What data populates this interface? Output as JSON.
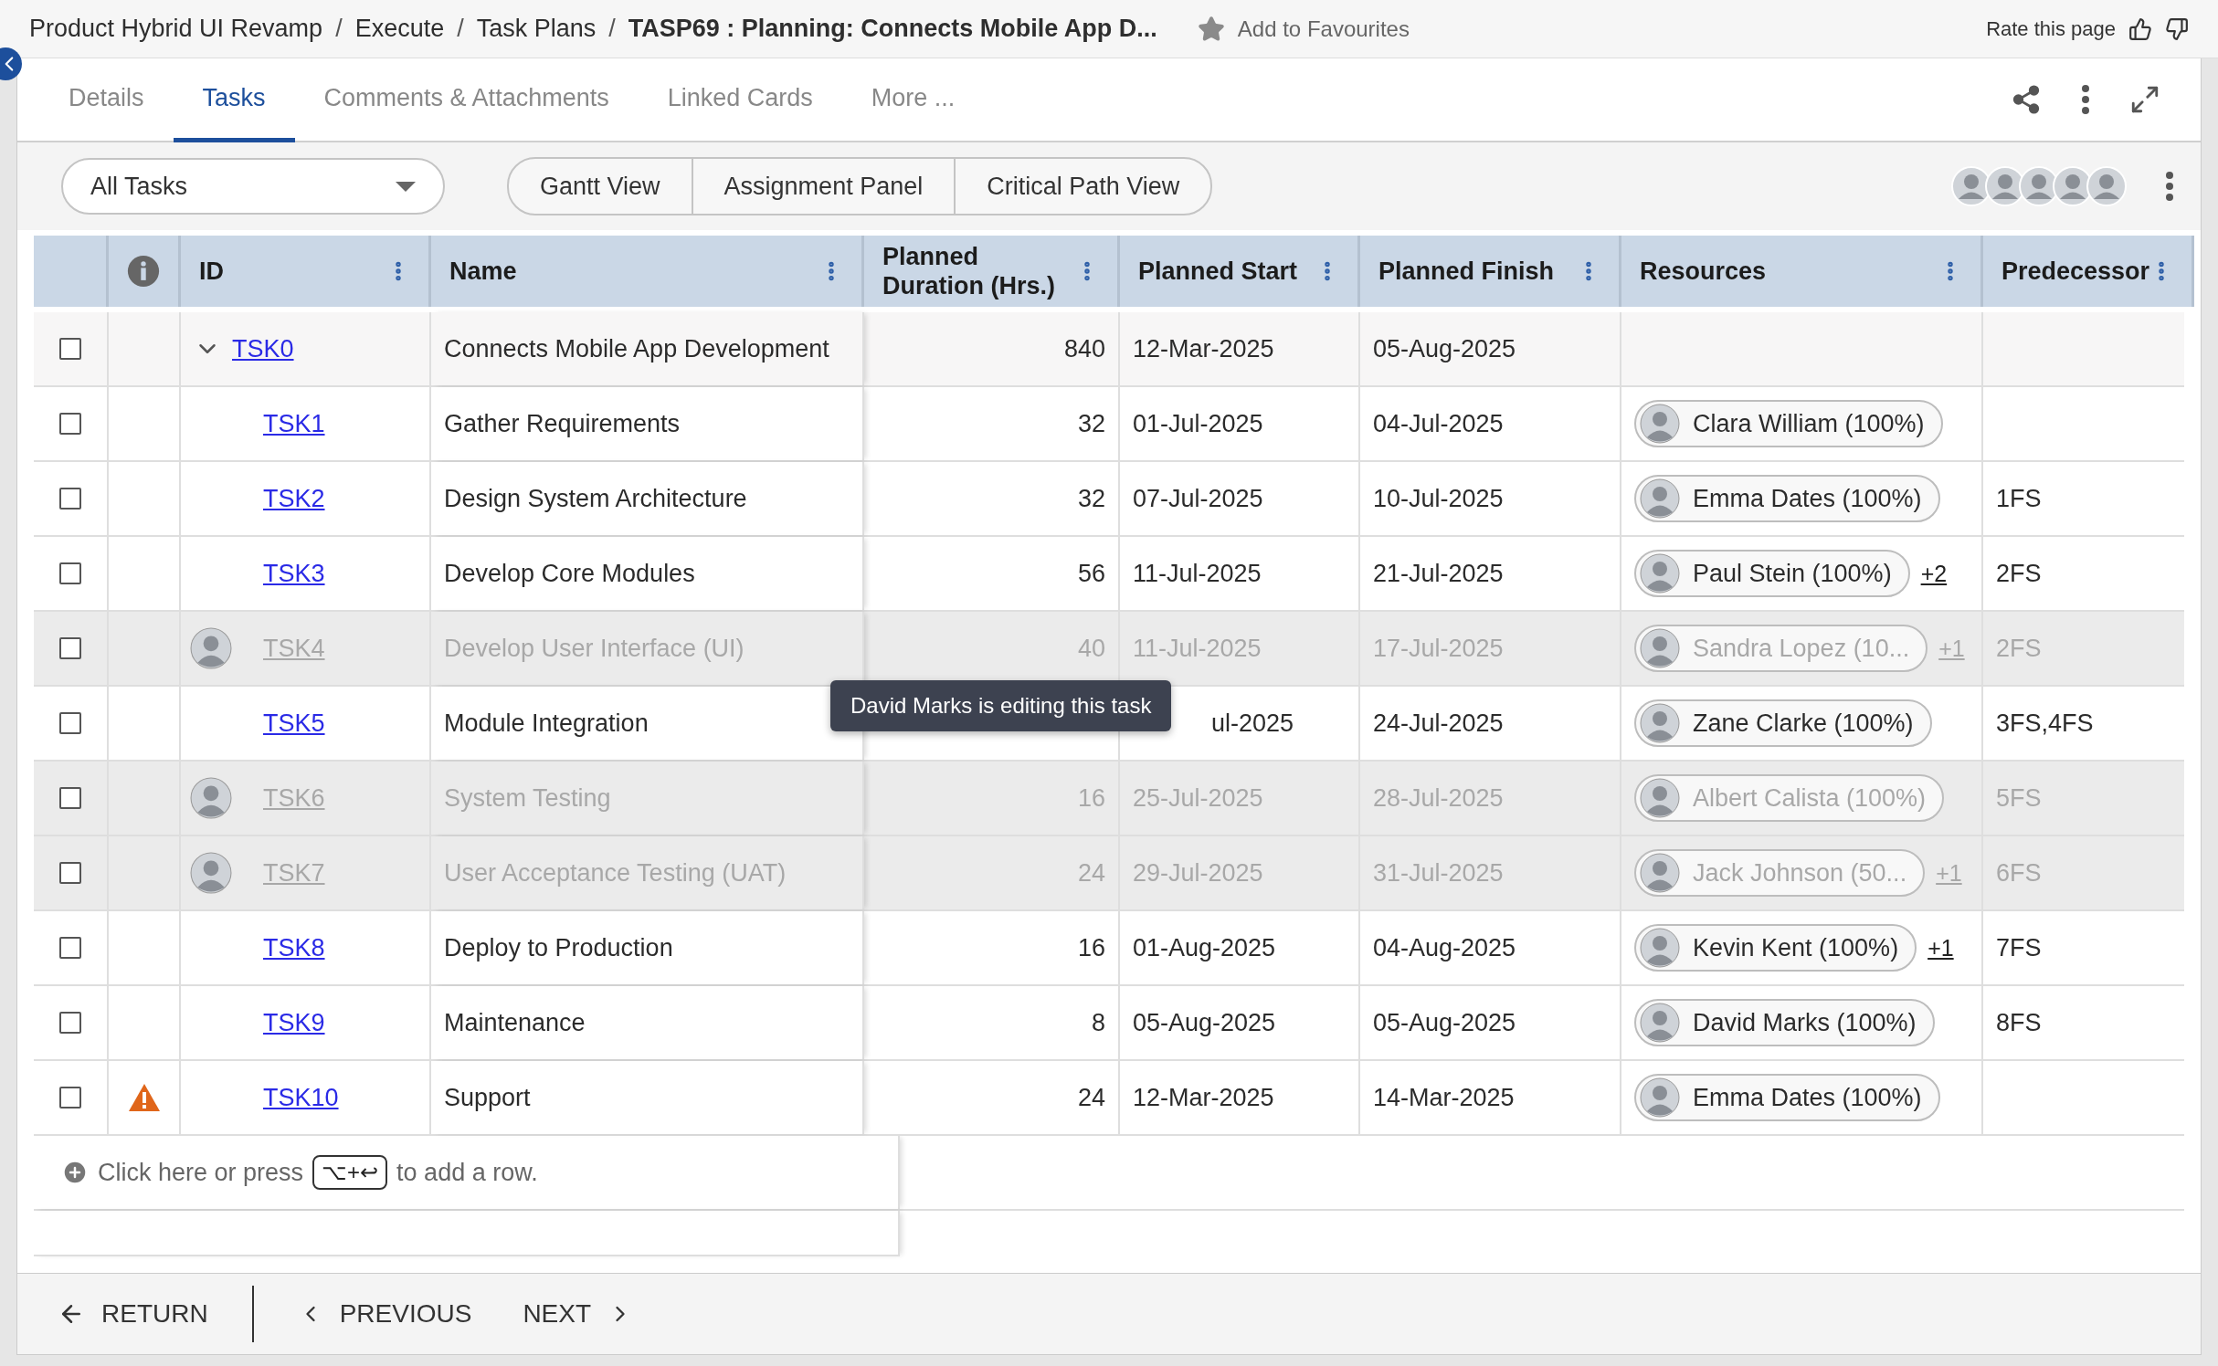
{
  "breadcrumb": {
    "parents": [
      "Product Hybrid UI Revamp",
      "Execute",
      "Task Plans"
    ],
    "current": "TASP69 : Planning: Connects Mobile App D...",
    "separator": "/"
  },
  "favourite": {
    "label": "Add to Favourites",
    "on": false
  },
  "rate_label": "Rate this page",
  "tabs": [
    {
      "label": "Details",
      "selected": false
    },
    {
      "label": "Tasks",
      "selected": true
    },
    {
      "label": "Comments & Attachments",
      "selected": false
    },
    {
      "label": "Linked Cards",
      "selected": false
    },
    {
      "label": "More ...",
      "selected": false
    }
  ],
  "view_filter": {
    "value": "All Tasks"
  },
  "view_buttons": [
    "Gantt View",
    "Assignment Panel",
    "Critical Path View"
  ],
  "columns": [
    {
      "kind": "select"
    },
    {
      "kind": "info"
    },
    {
      "kind": "text",
      "label": "ID"
    },
    {
      "kind": "text",
      "label": "Name"
    },
    {
      "kind": "text",
      "label": "Planned Duration (Hrs.)"
    },
    {
      "kind": "text",
      "label": "Planned Start"
    },
    {
      "kind": "text",
      "label": "Planned Finish"
    },
    {
      "kind": "text",
      "label": "Resources"
    },
    {
      "kind": "text",
      "label": "Predecessor"
    }
  ],
  "rows": [
    {
      "id": "TSK0",
      "name": "Connects Mobile App Development",
      "duration": "840",
      "start": "12-Mar-2025",
      "finish": "05-Aug-2025",
      "checked": false,
      "expanded": true,
      "children": [
        {
          "id": "TSK1",
          "name": "Gather Requirements",
          "duration": "32",
          "start": "01-Jul-2025",
          "finish": "04-Jul-2025",
          "resource": "Clara William (100%)",
          "checked": false,
          "locked": false,
          "warning": false
        },
        {
          "id": "TSK2",
          "name": "Design System Architecture",
          "duration": "32",
          "start": "07-Jul-2025",
          "finish": "10-Jul-2025",
          "resource": "Emma Dates (100%)",
          "predecessor": "1FS",
          "checked": false,
          "locked": false,
          "warning": false
        },
        {
          "id": "TSK3",
          "name": "Develop Core Modules",
          "duration": "56",
          "start": "11-Jul-2025",
          "finish": "21-Jul-2025",
          "resource": "Paul Stein (100%)",
          "more": "+2",
          "predecessor": "2FS",
          "checked": false,
          "locked": false,
          "warning": false
        },
        {
          "id": "TSK4",
          "name": "Develop User Interface (UI)",
          "duration": "40",
          "start": "11-Jul-2025",
          "finish": "17-Jul-2025",
          "resource": "Sandra Lopez (10...",
          "more": "+1",
          "predecessor": "2FS",
          "checked": false,
          "locked": true,
          "warning": false
        },
        {
          "id": "TSK5",
          "name": "Module Integration",
          "start": "ul-2025",
          "finish": "24-Jul-2025",
          "resource": "Zane Clarke (100%)",
          "predecessor": "3FS,4FS",
          "checked": false,
          "locked": false,
          "warning": false,
          "tooltip": "David Marks is editing this task"
        },
        {
          "id": "TSK6",
          "name": "System Testing",
          "duration": "16",
          "start": "25-Jul-2025",
          "finish": "28-Jul-2025",
          "resource": "Albert Calista (100%)",
          "predecessor": "5FS",
          "checked": false,
          "locked": true,
          "warning": false
        },
        {
          "id": "TSK7",
          "name": "User Acceptance Testing (UAT)",
          "duration": "24",
          "start": "29-Jul-2025",
          "finish": "31-Jul-2025",
          "resource": "Jack Johnson (50...",
          "more": "+1",
          "predecessor": "6FS",
          "checked": false,
          "locked": true,
          "warning": false
        },
        {
          "id": "TSK8",
          "name": "Deploy to Production",
          "duration": "16",
          "start": "01-Aug-2025",
          "finish": "04-Aug-2025",
          "resource": "Kevin Kent (100%)",
          "more": "+1",
          "predecessor": "7FS",
          "checked": false,
          "locked": false,
          "warning": false
        },
        {
          "id": "TSK9",
          "name": "Maintenance",
          "duration": "8",
          "start": "05-Aug-2025",
          "finish": "05-Aug-2025",
          "resource": "David Marks (100%)",
          "predecessor": "8FS",
          "checked": false,
          "locked": false,
          "warning": false
        },
        {
          "id": "TSK10",
          "name": "Support",
          "duration": "24",
          "start": "12-Mar-2025",
          "finish": "14-Mar-2025",
          "resource": "Emma Dates (100%)",
          "checked": false,
          "locked": false,
          "warning": true
        }
      ]
    }
  ],
  "add_row": {
    "before": "Click here or press",
    "key": "⌥+↩",
    "after": "to add a row."
  },
  "footer": {
    "return": "RETURN",
    "previous": "PREVIOUS",
    "next": "NEXT"
  }
}
